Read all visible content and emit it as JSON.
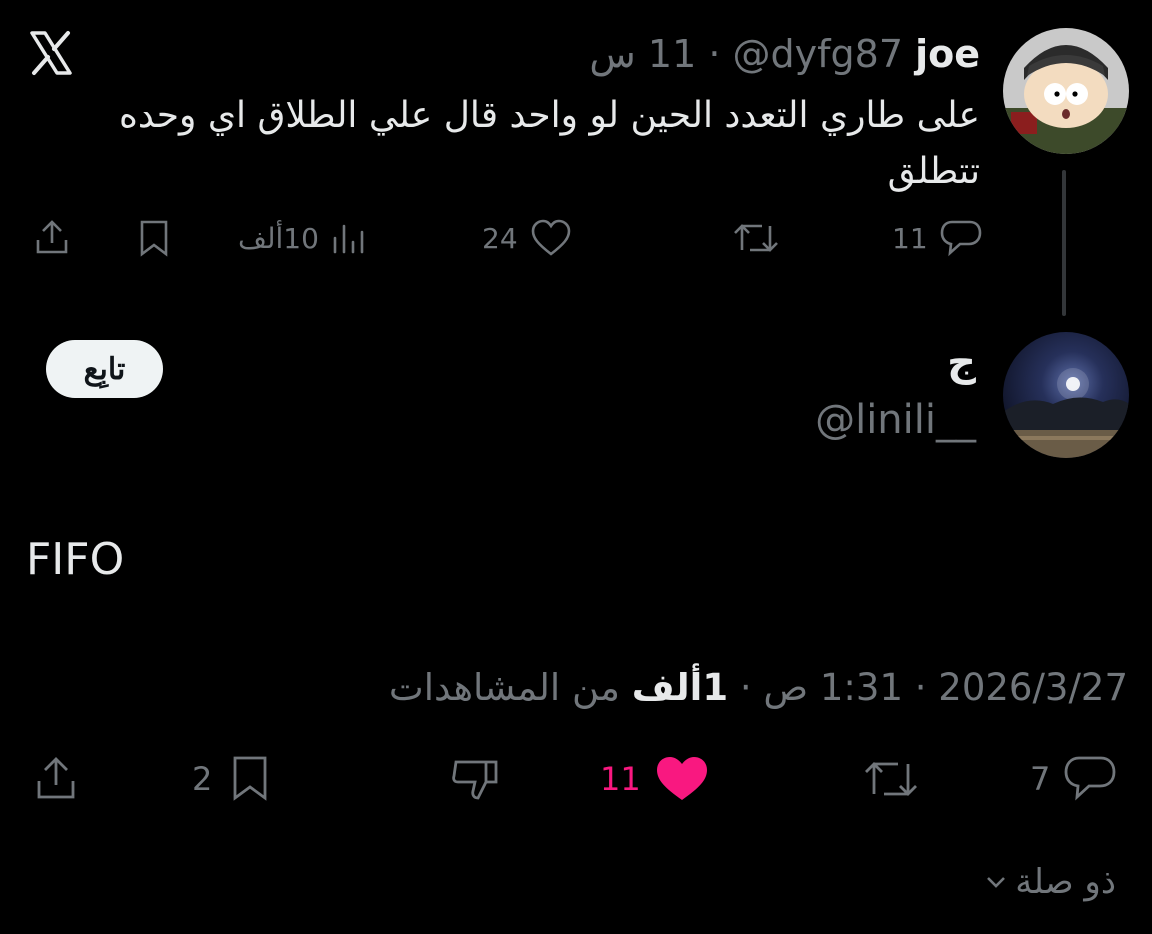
{
  "app": {
    "logo_icon": "x-logo-icon"
  },
  "parent_tweet": {
    "name": "joe",
    "handle": "@dyfg87",
    "separator": "·",
    "time": "11 س",
    "text": "على طاري التعدد الحين لو واحد قال علي الطلاق اي وحده تتطلق",
    "actions": {
      "replies": "11",
      "likes": "24",
      "views": "10ألف"
    }
  },
  "reply_author": {
    "name": "ج",
    "handle": "@linili__",
    "follow_label": "تابِع"
  },
  "reply_tweet": {
    "text": "FIFO",
    "date": "2026/3/27",
    "time": "1:31 ص",
    "separator": "·",
    "views_count": "1ألف",
    "views_label": "من المشاهدات",
    "actions": {
      "replies": "7",
      "likes": "11",
      "bookmarks": "2"
    }
  },
  "related_label": "ذو صلة",
  "colors": {
    "background": "#000000",
    "text": "#e7e9ea",
    "muted": "#71767b",
    "like_active": "#f91880",
    "follow_bg": "#eff3f4"
  }
}
